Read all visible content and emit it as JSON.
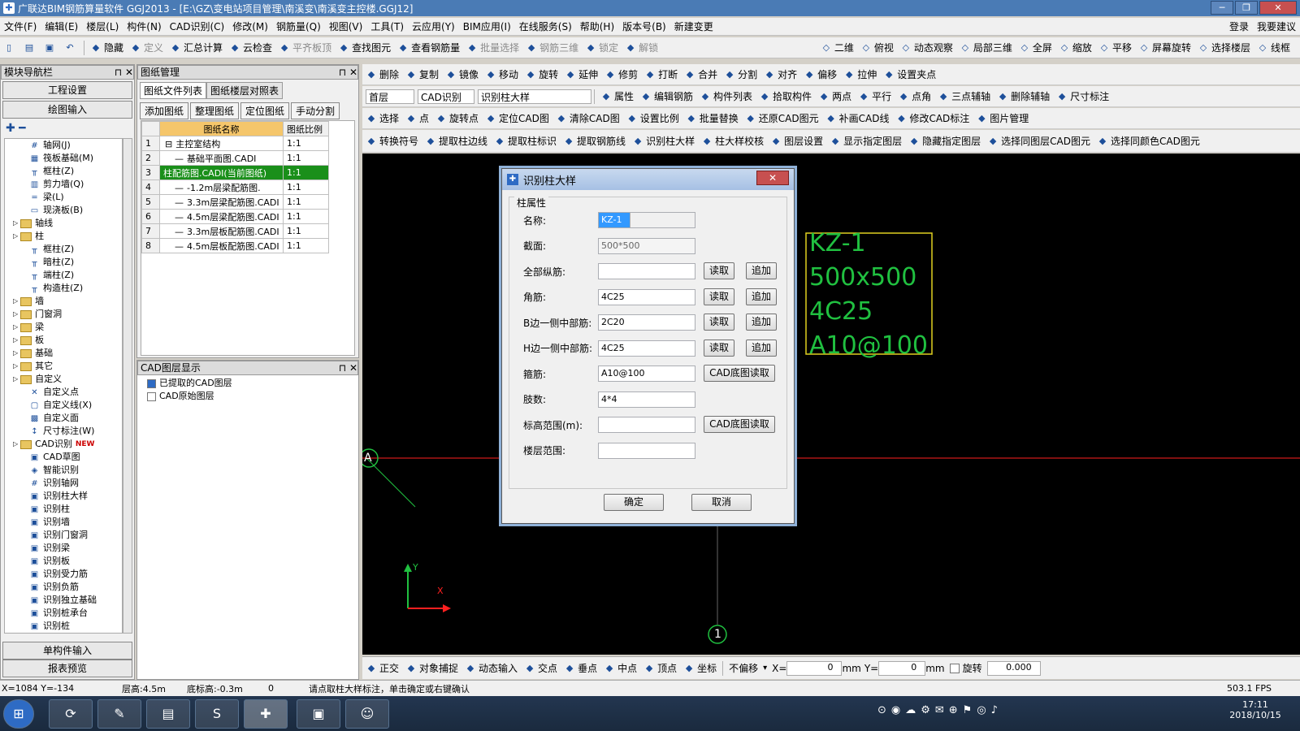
{
  "window": {
    "title": "广联达BIM钢筋算量软件 GGJ2013 - [E:\\GZ\\变电站项目管理\\南溪变\\南溪变主控楼.GGJ12]",
    "min": "─",
    "max": "❐",
    "close": "✕"
  },
  "menu": [
    "文件(F)",
    "编辑(E)",
    "楼层(L)",
    "构件(N)",
    "CAD识别(C)",
    "修改(M)",
    "钢筋量(Q)",
    "视图(V)",
    "工具(T)",
    "云应用(Y)",
    "BIM应用(I)",
    "在线服务(S)",
    "帮助(H)",
    "版本号(B)",
    "新建变更"
  ],
  "menu_right": [
    "登录",
    "我要建议"
  ],
  "toolbar1": [
    {
      "label": "隐藏",
      "dis": false
    },
    {
      "label": "定义",
      "dis": true
    },
    {
      "label": "汇总计算",
      "dis": false
    },
    {
      "label": "云检查",
      "dis": false
    },
    {
      "label": "平齐板顶",
      "dis": true
    },
    {
      "label": "查找图元",
      "dis": false
    },
    {
      "label": "查看钢筋量",
      "dis": false
    },
    {
      "label": "批量选择",
      "dis": true
    },
    {
      "label": "钢筋三维",
      "dis": true
    },
    {
      "label": "锁定",
      "dis": true
    },
    {
      "label": "解锁",
      "dis": true
    }
  ],
  "toolbar1_right": [
    "二维",
    "俯视",
    "动态观察",
    "局部三维",
    "全屏",
    "缩放",
    "平移",
    "屏幕旋转",
    "选择楼层",
    "线框"
  ],
  "nav": {
    "header": "模块导航栏",
    "btn_engineering": "工程设置",
    "btn_drawing": "绘图输入",
    "btn_single": "单构件输入",
    "btn_report": "报表预览"
  },
  "tree": [
    {
      "label": "轴网(J)",
      "indent": 3,
      "type": "icon",
      "icon": "#"
    },
    {
      "label": "筏板基础(M)",
      "indent": 3,
      "type": "icon",
      "icon": "▦"
    },
    {
      "label": "框柱(Z)",
      "indent": 3,
      "type": "icon",
      "icon": "╥"
    },
    {
      "label": "剪力墙(Q)",
      "indent": 3,
      "type": "icon",
      "icon": "▥"
    },
    {
      "label": "梁(L)",
      "indent": 3,
      "type": "icon",
      "icon": "═"
    },
    {
      "label": "现浇板(B)",
      "indent": 3,
      "type": "icon",
      "icon": "▭"
    },
    {
      "label": "轴线",
      "indent": 1,
      "type": "folder"
    },
    {
      "label": "柱",
      "indent": 1,
      "type": "folder"
    },
    {
      "label": "框柱(Z)",
      "indent": 3,
      "type": "icon",
      "icon": "╥"
    },
    {
      "label": "暗柱(Z)",
      "indent": 3,
      "type": "icon",
      "icon": "╥"
    },
    {
      "label": "端柱(Z)",
      "indent": 3,
      "type": "icon",
      "icon": "╥"
    },
    {
      "label": "构造柱(Z)",
      "indent": 3,
      "type": "icon",
      "icon": "╥"
    },
    {
      "label": "墙",
      "indent": 1,
      "type": "folder"
    },
    {
      "label": "门窗洞",
      "indent": 1,
      "type": "folder"
    },
    {
      "label": "梁",
      "indent": 1,
      "type": "folder"
    },
    {
      "label": "板",
      "indent": 1,
      "type": "folder"
    },
    {
      "label": "基础",
      "indent": 1,
      "type": "folder"
    },
    {
      "label": "其它",
      "indent": 1,
      "type": "folder"
    },
    {
      "label": "自定义",
      "indent": 1,
      "type": "folder"
    },
    {
      "label": "自定义点",
      "indent": 3,
      "type": "icon",
      "icon": "✕"
    },
    {
      "label": "自定义线(X)",
      "indent": 3,
      "type": "icon",
      "icon": "▢"
    },
    {
      "label": "自定义面",
      "indent": 3,
      "type": "icon",
      "icon": "▩"
    },
    {
      "label": "尺寸标注(W)",
      "indent": 3,
      "type": "icon",
      "icon": "↕"
    },
    {
      "label": "CAD识别",
      "indent": 1,
      "type": "folder",
      "badge": "NEW"
    },
    {
      "label": "CAD草图",
      "indent": 3,
      "type": "icon",
      "icon": "▣"
    },
    {
      "label": "智能识别",
      "indent": 3,
      "type": "icon",
      "icon": "◈"
    },
    {
      "label": "识别轴网",
      "indent": 3,
      "type": "icon",
      "icon": "#"
    },
    {
      "label": "识别柱大样",
      "indent": 3,
      "type": "icon",
      "icon": "▣"
    },
    {
      "label": "识别柱",
      "indent": 3,
      "type": "icon",
      "icon": "▣"
    },
    {
      "label": "识别墙",
      "indent": 3,
      "type": "icon",
      "icon": "▣"
    },
    {
      "label": "识别门窗洞",
      "indent": 3,
      "type": "icon",
      "icon": "▣"
    },
    {
      "label": "识别梁",
      "indent": 3,
      "type": "icon",
      "icon": "▣"
    },
    {
      "label": "识别板",
      "indent": 3,
      "type": "icon",
      "icon": "▣"
    },
    {
      "label": "识别受力筋",
      "indent": 3,
      "type": "icon",
      "icon": "▣"
    },
    {
      "label": "识别负筋",
      "indent": 3,
      "type": "icon",
      "icon": "▣"
    },
    {
      "label": "识别独立基础",
      "indent": 3,
      "type": "icon",
      "icon": "▣"
    },
    {
      "label": "识别桩承台",
      "indent": 3,
      "type": "icon",
      "icon": "▣"
    },
    {
      "label": "识别桩",
      "indent": 3,
      "type": "icon",
      "icon": "▣"
    }
  ],
  "drawing_mgmt": {
    "header": "图纸管理",
    "tabs": [
      "图纸文件列表",
      "图纸楼层对照表"
    ],
    "buttons": [
      "添加图纸",
      "整理图纸",
      "定位图纸",
      "手动分割"
    ],
    "col_name": "图纸名称",
    "col_ratio": "图纸比例",
    "rows": [
      {
        "no": "1",
        "name": "主控室结构",
        "ratio": "1:1",
        "prefix": "⊟"
      },
      {
        "no": "2",
        "name": "基础平面图.CADI",
        "ratio": "1:1",
        "prefix": "—"
      },
      {
        "no": "3",
        "name": "柱配筋图.CADI(当前图纸)",
        "ratio": "1:1",
        "prefix": ""
      },
      {
        "no": "4",
        "name": "-1.2m层梁配筋图.",
        "ratio": "1:1",
        "prefix": "—"
      },
      {
        "no": "5",
        "name": "3.3m层梁配筋图.CADI",
        "ratio": "1:1",
        "prefix": "—"
      },
      {
        "no": "6",
        "name": "4.5m层梁配筋图.CADI",
        "ratio": "1:1",
        "prefix": "—"
      },
      {
        "no": "7",
        "name": "3.3m层板配筋图.CADI",
        "ratio": "1:1",
        "prefix": "—"
      },
      {
        "no": "8",
        "name": "4.5m层板配筋图.CADI",
        "ratio": "1:1",
        "prefix": "—"
      }
    ]
  },
  "cad_layer": {
    "header": "CAD图层显示",
    "items": [
      "已提取的CAD图层",
      "CAD原始图层"
    ]
  },
  "toolbar_r1": [
    "删除",
    "复制",
    "镜像",
    "移动",
    "旋转",
    "延伸",
    "修剪",
    "打断",
    "合并",
    "分割",
    "对齐",
    "偏移",
    "拉伸",
    "设置夹点"
  ],
  "toolbar_r2": {
    "floor": "首层",
    "cad": "CAD识别",
    "item": "识别柱大样",
    "buttons": [
      "属性",
      "编辑钢筋",
      "构件列表",
      "拾取构件",
      "两点",
      "平行",
      "点角",
      "三点辅轴",
      "删除辅轴",
      "尺寸标注"
    ]
  },
  "toolbar_r3": [
    "选择",
    "点",
    "旋转点",
    "定位CAD图",
    "清除CAD图",
    "设置比例",
    "批量替换",
    "还原CAD图元",
    "补画CAD线",
    "修改CAD标注",
    "图片管理"
  ],
  "toolbar_r4": [
    "转换符号",
    "提取柱边线",
    "提取柱标识",
    "提取钢筋线",
    "识别柱大样",
    "柱大样校核",
    "图层设置",
    "显示指定图层",
    "隐藏指定图层",
    "选择同图层CAD图元",
    "选择同颜色CAD图元"
  ],
  "cad_text": [
    "KZ-1",
    "500x500",
    "4C25",
    "A10@100"
  ],
  "axis_labels": {
    "a": "A",
    "one": "1",
    "y": "Y",
    "x": "X"
  },
  "dialog": {
    "title": "识别柱大样",
    "group": "柱属性",
    "fields": [
      {
        "label": "名称:",
        "value": "KZ-1",
        "btns": []
      },
      {
        "label": "截面:",
        "value": "500*500",
        "btns": []
      },
      {
        "label": "全部纵筋:",
        "value": "",
        "btns": [
          "读取",
          "追加"
        ]
      },
      {
        "label": "角筋:",
        "value": "4C25",
        "btns": [
          "读取",
          "追加"
        ]
      },
      {
        "label": "B边一侧中部筋:",
        "value": "2C20",
        "btns": [
          "读取",
          "追加"
        ]
      },
      {
        "label": "H边一侧中部筋:",
        "value": "4C25",
        "btns": [
          "读取",
          "追加"
        ]
      },
      {
        "label": "箍筋:",
        "value": "A10@100",
        "btns": [
          "CAD底图读取"
        ]
      },
      {
        "label": "肢数:",
        "value": "4*4",
        "btns": []
      },
      {
        "label": "标高范围(m):",
        "value": "",
        "btns": [
          "CAD底图读取"
        ]
      },
      {
        "label": "楼层范围:",
        "value": "",
        "btns": []
      }
    ],
    "ok": "确定",
    "cancel": "取消",
    "close": "✕"
  },
  "snapbar": {
    "items": [
      "正交",
      "对象捕捉",
      "动态输入",
      "交点",
      "垂点",
      "中点",
      "顶点",
      "坐标"
    ],
    "offset": "不偏移",
    "x_label": "X=",
    "x_val": "0",
    "y_label": "Y=",
    "y_val": "0",
    "mm": "mm",
    "rotate": "旋转",
    "rotate_val": "0.000"
  },
  "status": {
    "coords": "X=1084 Y=-134",
    "floor_h": "层高:4.5m",
    "base_h": "底标高:-0.3m",
    "zero": "0",
    "hint": "请点取柱大样标注，单击确定或右键确认",
    "fps": "503.1 FPS"
  },
  "taskbar": {
    "time": "17:11",
    "date": "2018/10/15"
  }
}
